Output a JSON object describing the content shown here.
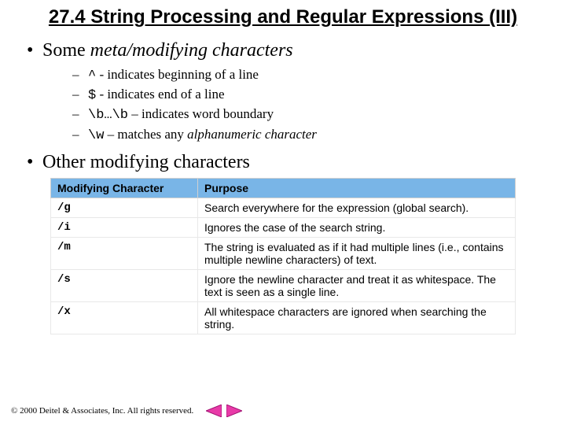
{
  "title": "27.4 String Processing and Regular Expressions (III)",
  "bullets": {
    "b1a_pre": "Some ",
    "b1a_em": "meta/modifying characters",
    "items": [
      {
        "code": "^",
        "rest": " - indicates beginning of a line"
      },
      {
        "code": "$",
        "rest": " - indicates end of a line"
      },
      {
        "code": "\\b…\\b",
        "rest": " – indicates word boundary"
      },
      {
        "code": "\\w",
        "rest_pre": " – matches any ",
        "rest_em": "alphanumeric character"
      }
    ],
    "b1b": "Other modifying characters"
  },
  "table": {
    "head_char": "Modifying Character",
    "head_purpose": "Purpose",
    "rows": [
      {
        "char": "/g",
        "purpose": "Search everywhere for the expression (global search)."
      },
      {
        "char": "/i",
        "purpose": "Ignores the case of the search string."
      },
      {
        "char": "/m",
        "purpose": "The string is evaluated as if it had multiple lines (i.e., contains multiple newline characters) of text."
      },
      {
        "char": "/s",
        "purpose": "Ignore the newline character and treat it as whitespace. The text is seen as a single line."
      },
      {
        "char": "/x",
        "purpose": "All whitespace characters are ignored when searching the string."
      }
    ]
  },
  "footer": {
    "copyright": "© 2000 Deitel & Associates, Inc.  All rights reserved."
  }
}
